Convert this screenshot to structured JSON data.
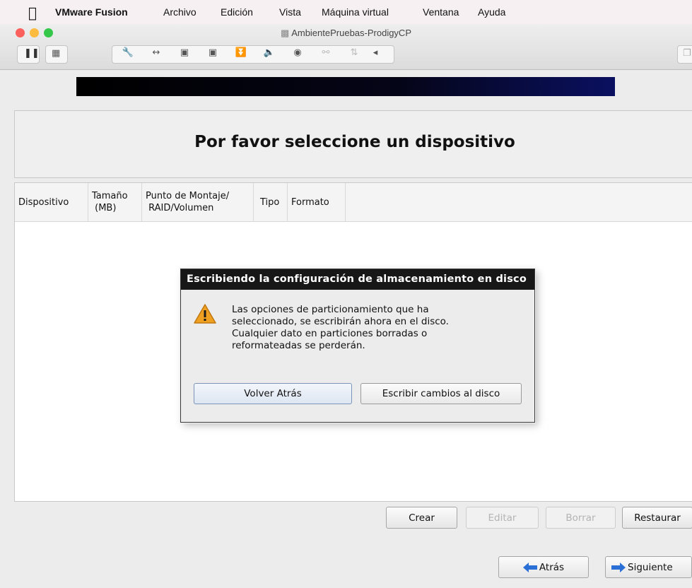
{
  "menubar": {
    "app_name": "VMware Fusion",
    "items": [
      "Archivo",
      "Edición",
      "Vista",
      "Máquina virtual",
      "Ventana",
      "Ayuda"
    ]
  },
  "window": {
    "title": "AmbientePruebas-ProdigyCP"
  },
  "installer": {
    "page_title": "Por favor seleccione un dispositivo",
    "table_headers": {
      "device": "Dispositivo",
      "size_1": "Tamaño",
      "size_2": "(MB)",
      "mount_1": "Punto de Montaje/",
      "mount_2": "RAID/Volumen",
      "type": "Tipo",
      "format": "Formato"
    },
    "actions": {
      "create": "Crear",
      "edit": "Editar",
      "delete": "Borrar",
      "restore": "Restaurar"
    },
    "nav": {
      "back": "Atrás",
      "next": "Siguiente"
    }
  },
  "dialog": {
    "title": "Escribiendo la configuración de almacenamiento en disco",
    "message_lines": [
      "Las opciones de particionamiento que ha",
      "seleccionado, se escribirán ahora en el disco.",
      "Cualquier dato en particiones borradas o",
      "reformateadas se perderán."
    ],
    "back_button": "Volver Atrás",
    "write_button": "Escribir cambios al disco"
  },
  "colors": {
    "light_close": "#fc605c",
    "light_min": "#fdbc40",
    "light_max": "#34c749",
    "warning": "#f0a020",
    "nav_arrow": "#2a6fd6"
  }
}
